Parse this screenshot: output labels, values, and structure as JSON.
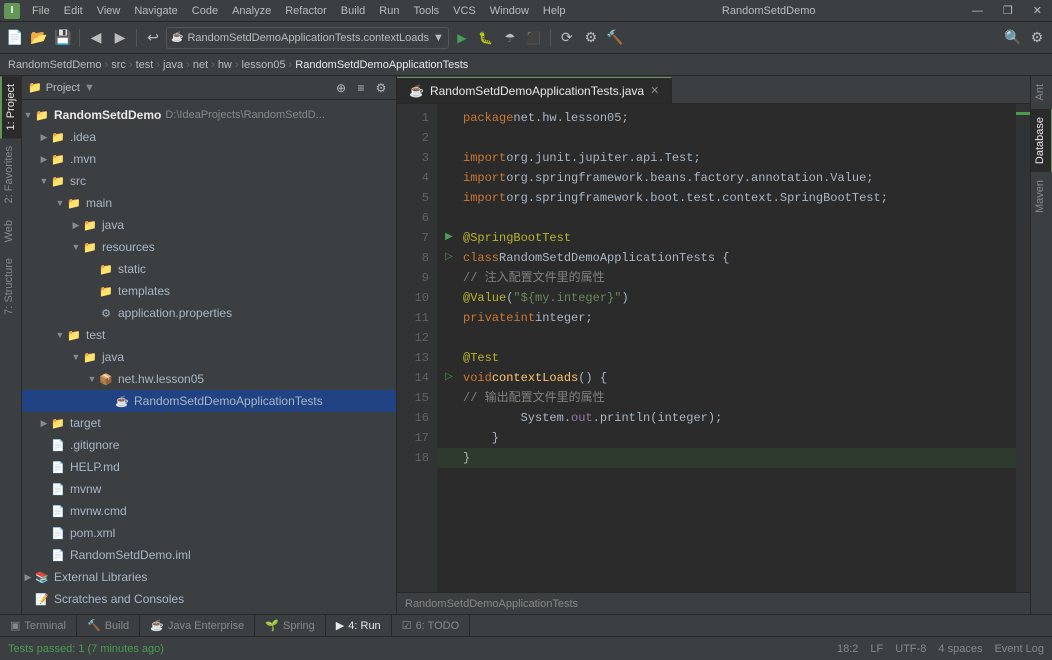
{
  "app": {
    "title": "RandomSetdDemo",
    "window_controls": [
      "—",
      "❐",
      "✕"
    ]
  },
  "menubar": {
    "items": [
      "File",
      "Edit",
      "View",
      "Navigate",
      "Code",
      "Analyze",
      "Refactor",
      "Build",
      "Run",
      "Tools",
      "VCS",
      "Window",
      "Help"
    ]
  },
  "toolbar": {
    "combo_text": "RandomSetdDemoApplicationTests.contextLoads",
    "run_configs": [
      "▶",
      "🐛",
      "⟳",
      "⬛",
      "▶▶",
      "📊",
      "🔧",
      "🔨",
      "🔍"
    ]
  },
  "breadcrumb": {
    "parts": [
      "RandomSetdDemo",
      "src",
      "test",
      "java",
      "net",
      "hw",
      "lesson05",
      "RandomSetdDemoApplicationTests"
    ]
  },
  "sidebar": {
    "title": "Project",
    "tree": [
      {
        "id": "root",
        "indent": 0,
        "arrow": "▼",
        "icon": "📁",
        "icon_color": "#7ec8e3",
        "label": "RandomSetdDemo",
        "extra": "D:\\IdeaProjects\\RandomSetdD...",
        "bold": true
      },
      {
        "id": "idea",
        "indent": 1,
        "arrow": "▶",
        "icon": "📁",
        "icon_color": "#7ec8e3",
        "label": ".idea",
        "extra": ""
      },
      {
        "id": "mvn",
        "indent": 1,
        "arrow": "▶",
        "icon": "📁",
        "icon_color": "#7ec8e3",
        "label": ".mvn",
        "extra": ""
      },
      {
        "id": "src",
        "indent": 1,
        "arrow": "▼",
        "icon": "📁",
        "icon_color": "#7ec8e3",
        "label": "src",
        "extra": ""
      },
      {
        "id": "main",
        "indent": 2,
        "arrow": "▼",
        "icon": "📁",
        "icon_color": "#7ec8e3",
        "label": "main",
        "extra": ""
      },
      {
        "id": "java",
        "indent": 3,
        "arrow": "▶",
        "icon": "📁",
        "icon_color": "#7ec8e3",
        "label": "java",
        "extra": ""
      },
      {
        "id": "resources",
        "indent": 3,
        "arrow": "▼",
        "icon": "📁",
        "icon_color": "#7ec8e3",
        "label": "resources",
        "extra": ""
      },
      {
        "id": "static",
        "indent": 4,
        "arrow": "",
        "icon": "📁",
        "icon_color": "#7ec8e3",
        "label": "static",
        "extra": ""
      },
      {
        "id": "templates",
        "indent": 4,
        "arrow": "",
        "icon": "📁",
        "icon_color": "#7ec8e3",
        "label": "templates",
        "extra": ""
      },
      {
        "id": "appprops",
        "indent": 4,
        "arrow": "",
        "icon": "⚙",
        "icon_color": "#a9b7c6",
        "label": "application.properties",
        "extra": ""
      },
      {
        "id": "test",
        "indent": 2,
        "arrow": "▼",
        "icon": "📁",
        "icon_color": "#7ec8e3",
        "label": "test",
        "extra": ""
      },
      {
        "id": "testjava",
        "indent": 3,
        "arrow": "▼",
        "icon": "📁",
        "icon_color": "#7ec8e3",
        "label": "java",
        "extra": ""
      },
      {
        "id": "nethwlesson05",
        "indent": 4,
        "arrow": "▼",
        "icon": "📦",
        "icon_color": "#a9b7c6",
        "label": "net.hw.lesson05",
        "extra": ""
      },
      {
        "id": "testfile",
        "indent": 5,
        "arrow": "",
        "icon": "☕",
        "icon_color": "#a9b7c6",
        "label": "RandomSetdDemoApplicationTests",
        "extra": "",
        "selected": true
      },
      {
        "id": "target",
        "indent": 1,
        "arrow": "▶",
        "icon": "📁",
        "icon_color": "#7ec8e3",
        "label": "target",
        "extra": ""
      },
      {
        "id": "gitignore",
        "indent": 1,
        "arrow": "",
        "icon": "📄",
        "icon_color": "#a9b7c6",
        "label": ".gitignore",
        "extra": ""
      },
      {
        "id": "helpmd",
        "indent": 1,
        "arrow": "",
        "icon": "📄",
        "icon_color": "#a9b7c6",
        "label": "HELP.md",
        "extra": ""
      },
      {
        "id": "mvnw",
        "indent": 1,
        "arrow": "",
        "icon": "📄",
        "icon_color": "#a9b7c6",
        "label": "mvnw",
        "extra": ""
      },
      {
        "id": "mvnwcmd",
        "indent": 1,
        "arrow": "",
        "icon": "📄",
        "icon_color": "#a9b7c6",
        "label": "mvnw.cmd",
        "extra": ""
      },
      {
        "id": "pomxml",
        "indent": 1,
        "arrow": "",
        "icon": "📄",
        "icon_color": "#f0a868",
        "label": "pom.xml",
        "extra": ""
      },
      {
        "id": "iml",
        "indent": 1,
        "arrow": "",
        "icon": "📄",
        "icon_color": "#a9b7c6",
        "label": "RandomSetdDemo.iml",
        "extra": ""
      },
      {
        "id": "extlibs",
        "indent": 0,
        "arrow": "▶",
        "icon": "📚",
        "icon_color": "#a9b7c6",
        "label": "External Libraries",
        "extra": ""
      },
      {
        "id": "scratchconsoles",
        "indent": 0,
        "arrow": "",
        "icon": "📝",
        "icon_color": "#a9b7c6",
        "label": "Scratches and Consoles",
        "extra": ""
      }
    ]
  },
  "editor": {
    "tabs": [
      {
        "id": "test-tab",
        "label": "RandomSetdDemoApplicationTests.java",
        "active": true,
        "icon": "☕"
      }
    ],
    "filename": "RandomSetdDemoApplicationTests.java",
    "lines": [
      {
        "num": 1,
        "gutter": "",
        "content": "<span class='kw'>package</span> <span class='pkg'>net.hw.lesson05</span>;"
      },
      {
        "num": 2,
        "gutter": "",
        "content": ""
      },
      {
        "num": 3,
        "gutter": "",
        "content": "<span class='kw'>import</span> <span class='pkg'>org.junit.jupiter.api.Test</span>;"
      },
      {
        "num": 4,
        "gutter": "",
        "content": "<span class='kw'>import</span> <span class='pkg'>org.springframework.beans.factory.annotation.Value</span>;"
      },
      {
        "num": 5,
        "gutter": "",
        "content": "<span class='kw'>import</span> <span class='pkg'>org.springframework.boot.test.context.SpringBootTest</span>;"
      },
      {
        "num": 6,
        "gutter": "",
        "content": ""
      },
      {
        "num": 7,
        "gutter": "▶",
        "content": "<span class='ann'>@SpringBootTest</span>"
      },
      {
        "num": 8,
        "gutter": "▷",
        "content": "<span class='kw'>class</span> <span class='cls'>RandomSetdDemoApplicationTests</span> {"
      },
      {
        "num": 9,
        "gutter": "",
        "content": "    <span class='cmt'>// 注入配置文件里的属性</span>"
      },
      {
        "num": 10,
        "gutter": "",
        "content": "    <span class='ann'>@Value</span>(<span class='str'>\"${my.integer}\"</span>)"
      },
      {
        "num": 11,
        "gutter": "",
        "content": "    <span class='kw'>private</span> <span class='kw2'>int</span> <span class='cls'>integer</span>;"
      },
      {
        "num": 12,
        "gutter": "",
        "content": ""
      },
      {
        "num": 13,
        "gutter": "",
        "content": "    <span class='ann'>@Test</span>"
      },
      {
        "num": 14,
        "gutter": "▷",
        "content": "    <span class='kw'>void</span> <span class='fn'>contextLoads</span>() {"
      },
      {
        "num": 15,
        "gutter": "",
        "content": "        <span class='cmt'>// 输出配置文件里的属性</span>"
      },
      {
        "num": 16,
        "gutter": "",
        "content": "        System.<span class='special'>out</span>.println(<span class='cls'>integer</span>);"
      },
      {
        "num": 17,
        "gutter": "",
        "content": "    }"
      },
      {
        "num": 18,
        "gutter": "",
        "content": "}",
        "highlighted": true
      }
    ],
    "footer": "RandomSetdDemoApplicationTests"
  },
  "right_tabs": [
    {
      "id": "ant",
      "label": "Ant"
    },
    {
      "id": "database",
      "label": "Database",
      "active": true
    },
    {
      "id": "maven",
      "label": "Maven"
    }
  ],
  "left_tabs": [
    {
      "id": "project",
      "label": "1: Project",
      "active": true
    },
    {
      "id": "favorites",
      "label": "2: Favorites"
    },
    {
      "id": "web",
      "label": "Web"
    },
    {
      "id": "structure",
      "label": "7: Structure"
    }
  ],
  "bottom_tabs": [
    {
      "id": "terminal",
      "label": "Terminal"
    },
    {
      "id": "build",
      "label": "Build"
    },
    {
      "id": "java-enterprise",
      "label": "Java Enterprise"
    },
    {
      "id": "spring",
      "label": "Spring"
    },
    {
      "id": "run",
      "label": "4: Run"
    },
    {
      "id": "todo",
      "label": "6: TODO"
    }
  ],
  "statusbar": {
    "left": "Tests passed: 1 (7 minutes ago)",
    "right_items": [
      "18:2",
      "LF",
      "UTF-8",
      "4 spaces",
      "Event Log"
    ]
  }
}
